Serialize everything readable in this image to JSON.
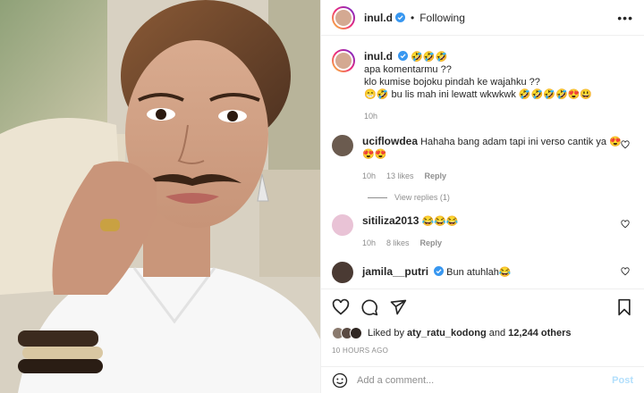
{
  "post": {
    "author": "inul.d",
    "separator": "•",
    "follow_status": "Following",
    "more_glyph": "•••",
    "photo_alt": "selfie"
  },
  "caption": {
    "username": "inul.d",
    "emojis_after_name": "🤣🤣🤣",
    "lines": [
      "apa komentarmu ??",
      "klo kumise bojoku pindah ke wajahku ??",
      "😁🤣 bu lis mah ini lewatt wkwkwk 🤣🤣🤣🤣😍😃"
    ],
    "time": "10h"
  },
  "comments": [
    {
      "username": "uciflowdea",
      "text": "Hahaha bang adam tapi ini verso cantik ya 😍😍😍",
      "time": "10h",
      "likes": "13 likes",
      "reply": "Reply",
      "view_replies": "View replies (1)"
    },
    {
      "username": "sitiliza2013",
      "text": "😂😂😂",
      "time": "10h",
      "likes": "8 likes",
      "reply": "Reply"
    },
    {
      "username": "jamila__putri",
      "verified": true,
      "text": "Bun atuhlah😂"
    }
  ],
  "likes": {
    "prefix": "Liked by",
    "user": "aty_ratu_kodong",
    "conjunction": "and",
    "count": "12,244 others"
  },
  "time_ago": "10 HOURS AGO",
  "comment_box": {
    "placeholder": "Add a comment...",
    "post_label": "Post"
  },
  "colors": {
    "verified": "#3897f0",
    "post_disabled": "#b2dffc",
    "muted": "#8e8e8e"
  },
  "icons": [
    "verified-icon",
    "more-icon",
    "heart-icon",
    "comment-icon",
    "share-icon",
    "bookmark-icon",
    "emoji-icon"
  ]
}
